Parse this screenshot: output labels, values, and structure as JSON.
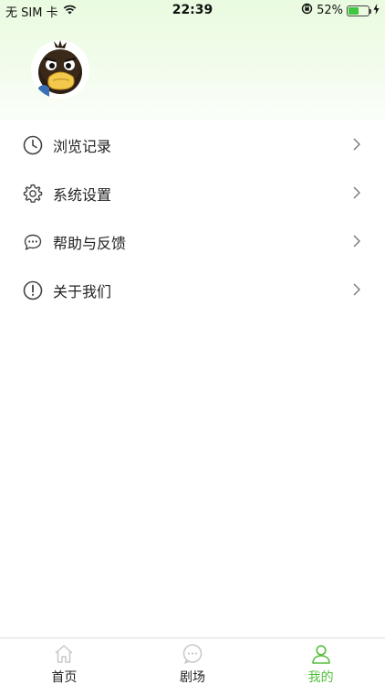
{
  "status_bar": {
    "carrier": "无 SIM 卡",
    "time": "22:39",
    "battery_percent": "52%",
    "battery_level": 0.52,
    "battery_color": "#3ec63e"
  },
  "profile": {
    "avatar_icon": "cartoon-bird-avatar"
  },
  "menu": {
    "items": [
      {
        "label": "浏览记录",
        "icon": "clock-icon"
      },
      {
        "label": "系统设置",
        "icon": "gear-icon"
      },
      {
        "label": "帮助与反馈",
        "icon": "chat-bubble-icon"
      },
      {
        "label": "关于我们",
        "icon": "info-icon"
      }
    ]
  },
  "tabbar": {
    "tabs": [
      {
        "label": "首页",
        "icon": "home-icon",
        "active": false
      },
      {
        "label": "剧场",
        "icon": "chat-icon",
        "active": false
      },
      {
        "label": "我的",
        "icon": "user-icon",
        "active": true
      }
    ],
    "active_color": "#55bf3b",
    "inactive_icon_color": "#c8c8c8"
  },
  "colors": {
    "header_gradient_top": "#e9fbe0",
    "accent": "#55bf3b"
  }
}
